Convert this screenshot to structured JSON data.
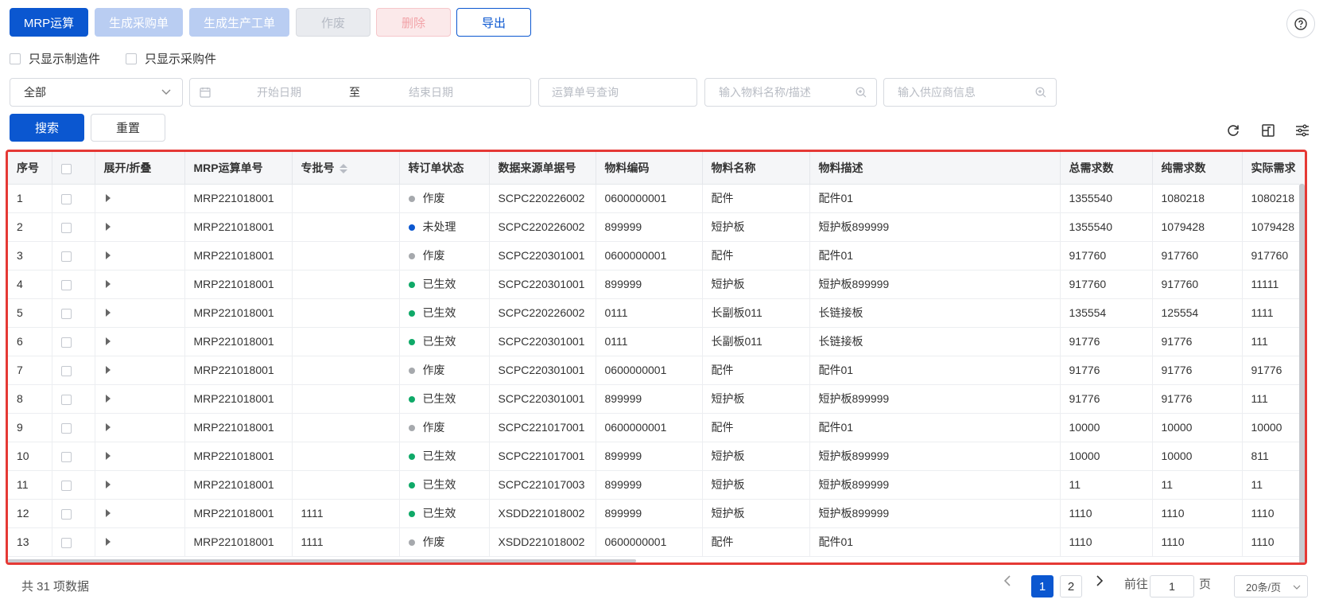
{
  "toolbar": {
    "mrp_run": "MRP运算",
    "gen_purchase": "生成采购单",
    "gen_production": "生成生产工单",
    "void": "作废",
    "delete": "删除",
    "export": "导出"
  },
  "filters": {
    "only_manufactured": "只显示制造件",
    "only_purchased": "只显示采购件",
    "status_select": "全部",
    "start_date": "开始日期",
    "date_sep": "至",
    "end_date": "结束日期",
    "run_no_placeholder": "运算单号查询",
    "material_placeholder": "输入物料名称/描述",
    "supplier_placeholder": "输入供应商信息"
  },
  "actions": {
    "search": "搜索",
    "reset": "重置"
  },
  "table": {
    "columns": [
      "序号",
      "",
      "展开/折叠",
      "MRP运算单号",
      "专批号",
      "转订单状态",
      "数据来源单据号",
      "物料编码",
      "物料名称",
      "物料描述",
      "总需求数",
      "纯需求数",
      "实际需求"
    ],
    "status_colors": {
      "作废": "#a6a9ad",
      "未处理": "#0b57d0",
      "已生效": "#0fa968"
    },
    "rows": [
      [
        "1",
        "MRP221018001",
        "",
        "作废",
        "SCPC220226002",
        "0600000001",
        "配件",
        "配件01",
        "1355540",
        "1080218",
        "1080218"
      ],
      [
        "2",
        "MRP221018001",
        "",
        "未处理",
        "SCPC220226002",
        "899999",
        "短护板",
        "短护板899999",
        "1355540",
        "1079428",
        "1079428"
      ],
      [
        "3",
        "MRP221018001",
        "",
        "作废",
        "SCPC220301001",
        "0600000001",
        "配件",
        "配件01",
        "917760",
        "917760",
        "917760"
      ],
      [
        "4",
        "MRP221018001",
        "",
        "已生效",
        "SCPC220301001",
        "899999",
        "短护板",
        "短护板899999",
        "917760",
        "917760",
        "11111"
      ],
      [
        "5",
        "MRP221018001",
        "",
        "已生效",
        "SCPC220226002",
        "0111",
        "长副板011",
        "长链接板",
        "135554",
        "125554",
        "1111"
      ],
      [
        "6",
        "MRP221018001",
        "",
        "已生效",
        "SCPC220301001",
        "0111",
        "长副板011",
        "长链接板",
        "91776",
        "91776",
        "111"
      ],
      [
        "7",
        "MRP221018001",
        "",
        "作废",
        "SCPC220301001",
        "0600000001",
        "配件",
        "配件01",
        "91776",
        "91776",
        "91776"
      ],
      [
        "8",
        "MRP221018001",
        "",
        "已生效",
        "SCPC220301001",
        "899999",
        "短护板",
        "短护板899999",
        "91776",
        "91776",
        "111"
      ],
      [
        "9",
        "MRP221018001",
        "",
        "作废",
        "SCPC221017001",
        "0600000001",
        "配件",
        "配件01",
        "10000",
        "10000",
        "10000"
      ],
      [
        "10",
        "MRP221018001",
        "",
        "已生效",
        "SCPC221017001",
        "899999",
        "短护板",
        "短护板899999",
        "10000",
        "10000",
        "811"
      ],
      [
        "11",
        "MRP221018001",
        "",
        "已生效",
        "SCPC221017003",
        "899999",
        "短护板",
        "短护板899999",
        "11",
        "11",
        "11"
      ],
      [
        "12",
        "MRP221018001",
        "1111",
        "已生效",
        "XSDD221018002",
        "899999",
        "短护板",
        "短护板899999",
        "1110",
        "1110",
        "1110"
      ],
      [
        "13",
        "MRP221018001",
        "1111",
        "作废",
        "XSDD221018002",
        "0600000001",
        "配件",
        "配件01",
        "1110",
        "1110",
        "1110"
      ]
    ]
  },
  "footer": {
    "total": "共 31 项数据",
    "pages": [
      "1",
      "2"
    ],
    "goto_label": "前往",
    "goto_value": "1",
    "page_unit": "页",
    "page_size": "20条/页"
  },
  "colors": {
    "primary": "#0b57d0",
    "highlight_border": "#e53935"
  }
}
